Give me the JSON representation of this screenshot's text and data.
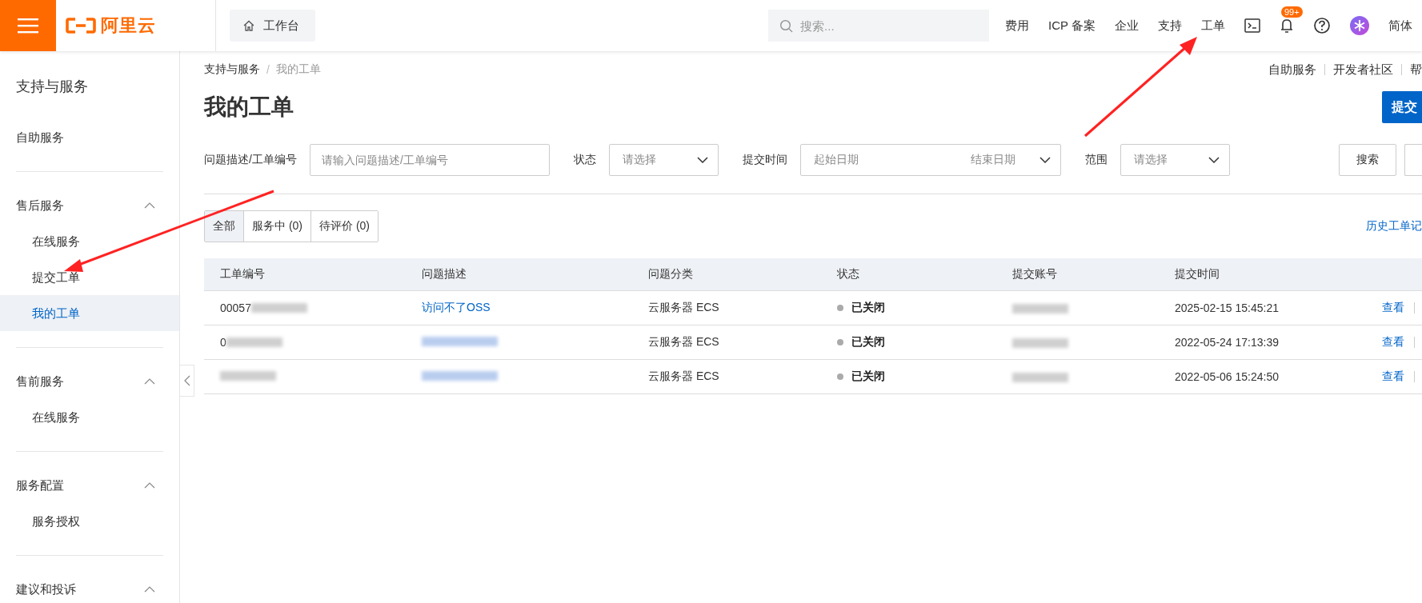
{
  "header": {
    "logo": "阿里云",
    "workbench": "工作台",
    "search": {
      "placeholder": "搜索..."
    },
    "nav": [
      "费用",
      "ICP 备案",
      "企业",
      "支持",
      "工单"
    ],
    "notifications": {
      "badge": "99+"
    },
    "language": "简体"
  },
  "sidebar": {
    "title": "支持与服务",
    "sections": [
      {
        "kind": "link",
        "label": "自助服务",
        "selected": false
      },
      {
        "kind": "group",
        "label": "售后服务",
        "expanded": true,
        "children": [
          {
            "label": "在线服务",
            "selected": false
          },
          {
            "label": "提交工单",
            "selected": false
          },
          {
            "label": "我的工单",
            "selected": true
          }
        ]
      },
      {
        "kind": "group",
        "label": "售前服务",
        "expanded": true,
        "children": [
          {
            "label": "在线服务",
            "selected": false
          }
        ]
      },
      {
        "kind": "group",
        "label": "服务配置",
        "expanded": true,
        "children": [
          {
            "label": "服务授权",
            "selected": false
          }
        ]
      },
      {
        "kind": "group",
        "label": "建议和投诉",
        "expanded": true
      }
    ]
  },
  "breadcrumb": [
    "支持与服务",
    "我的工单"
  ],
  "breadcrumb_separator": "/",
  "title": "我的工单",
  "top_links": [
    "自助服务",
    "开发者社区",
    "帮"
  ],
  "submit_button": "提交",
  "filters": [
    {
      "kind": "text",
      "label": "问题描述/工单编号",
      "placeholder": "请输入问题描述/工单编号"
    },
    {
      "kind": "select",
      "label": "状态",
      "placeholder": "请选择"
    },
    {
      "kind": "daterange",
      "label": "提交时间",
      "start_placeholder": "起始日期",
      "end_placeholder": "结束日期"
    },
    {
      "kind": "select",
      "label": "范围",
      "placeholder": "请选择"
    }
  ],
  "search_button": "搜索",
  "tabs": [
    {
      "label": "全部",
      "selected": true
    },
    {
      "label": "服务中 (0)",
      "selected": false
    },
    {
      "label": "待评价 (0)",
      "selected": false
    }
  ],
  "history_link": "历史工单记",
  "table": {
    "columns": [
      "工单编号",
      "问题描述",
      "问题分类",
      "状态",
      "提交账号",
      "提交时间"
    ],
    "rows": [
      {
        "id": {
          "text": "00057",
          "redacted": true
        },
        "description": {
          "text": "访问不了OSS",
          "redacted": false
        },
        "category": "云服务器 ECS",
        "status": {
          "text": "已关闭",
          "color": "#aaaaaa"
        },
        "account": {
          "redacted": true
        },
        "time": "2025-02-15 15:45:21",
        "action": "查看"
      },
      {
        "id": {
          "text": "0",
          "redacted": true
        },
        "description": {
          "redacted": true
        },
        "category": "云服务器 ECS",
        "status": {
          "text": "已关闭",
          "color": "#aaaaaa"
        },
        "account": {
          "redacted": true
        },
        "time": "2022-05-24 17:13:39",
        "action": "查看"
      },
      {
        "id": {
          "redacted": true
        },
        "description": {
          "redacted": true
        },
        "category": "云服务器 ECS",
        "status": {
          "text": "已关闭",
          "color": "#aaaaaa"
        },
        "account": {
          "redacted": true
        },
        "time": "2022-05-06 15:24:50",
        "action": "查看"
      }
    ]
  }
}
